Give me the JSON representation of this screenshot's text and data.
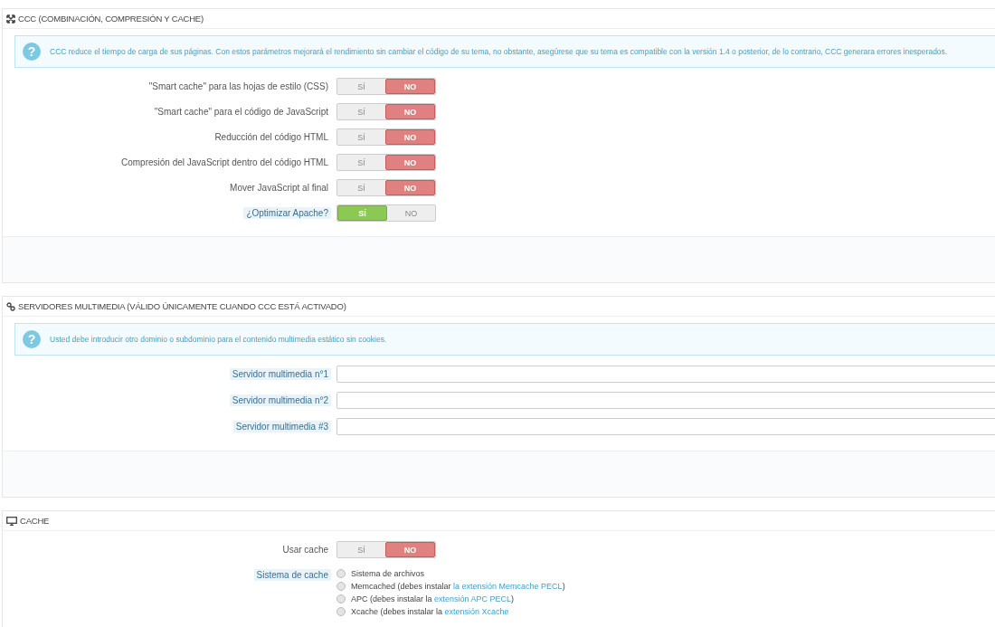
{
  "panels": [
    {
      "title": "CCC (COMBINACIÓN, COMPRESIÓN Y CACHE)",
      "help_mark": "?",
      "help": "CCC reduce el tiempo de carga de sus páginas. Con estos parámetros mejorará el rendimiento sin cambiar el código de su tema, no obstante, asegúrese que su tema es compatible con la versión 1.4 o posterior, de lo contrario, CCC generara errores inesperados.",
      "footer": true,
      "rows": [
        {
          "kind": "switch",
          "label": "\"Smart cache\" para las hojas de estilo (CSS)",
          "hint": false,
          "yes": "SÍ",
          "no": "NO",
          "on": false
        },
        {
          "kind": "switch",
          "label": "\"Smart cache\" para el código de JavaScript",
          "hint": false,
          "yes": "SÍ",
          "no": "NO",
          "on": false
        },
        {
          "kind": "switch",
          "label": "Reducción del código HTML",
          "hint": false,
          "yes": "SÍ",
          "no": "NO",
          "on": false
        },
        {
          "kind": "switch",
          "label": "Compresión del JavaScript dentro del código HTML",
          "hint": false,
          "yes": "SÍ",
          "no": "NO",
          "on": false
        },
        {
          "kind": "switch",
          "label": "Mover JavaScript al final",
          "hint": false,
          "yes": "SÍ",
          "no": "NO",
          "on": false
        },
        {
          "kind": "switch",
          "label": "¿Optimizar Apache?",
          "hint": true,
          "yes": "SÍ",
          "no": "NO",
          "on": true
        }
      ]
    },
    {
      "title": "SERVIDORES MULTIMEDIA (VÁLIDO ÚNICAMENTE CUANDO CCC ESTÁ ACTIVADO)",
      "help_mark": "?",
      "help": "Usted debe introducir otro dominio o subdominio para el contenido multimedia estático sin cookies.",
      "footer": true,
      "rows": [
        {
          "kind": "text",
          "label": "Servidor multimedia n°1",
          "hint": true
        },
        {
          "kind": "text",
          "label": "Servidor multimedia n°2",
          "hint": true
        },
        {
          "kind": "text",
          "label": "Servidor multimedia #3",
          "hint": true
        }
      ]
    },
    {
      "title": "CACHE",
      "footer": false,
      "rows": [
        {
          "kind": "switch",
          "label": "Usar cache",
          "hint": false,
          "yes": "SÍ",
          "no": "NO",
          "on": false
        },
        {
          "kind": "radio",
          "label": "Sistema de cache",
          "hint": true,
          "options": [
            {
              "text": "Sistema de archivos",
              "selected": false
            },
            {
              "text": "Memcached (debes instalar ",
              "link": "la extensión Memcache PECL",
              "after": ")",
              "selected": false
            },
            {
              "text": "APC (debes instalar la ",
              "link": "extensión APC PECL",
              "after": ")",
              "selected": false
            },
            {
              "text": "Xcache (debes instalar la ",
              "link": "extensión Xcache",
              "selected": false
            }
          ]
        }
      ]
    }
  ]
}
